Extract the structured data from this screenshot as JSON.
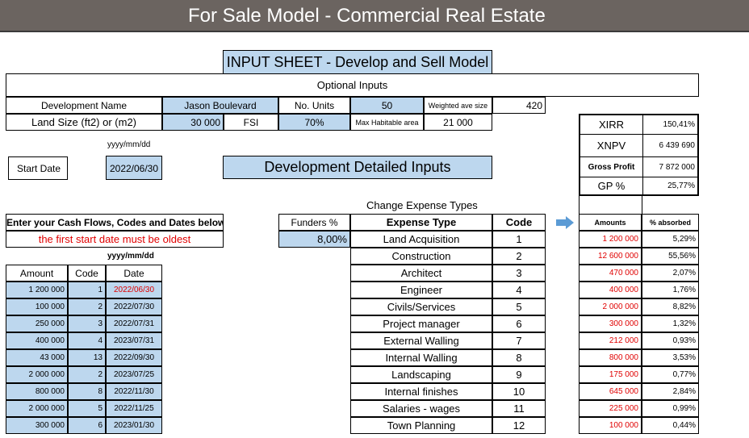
{
  "banner": {
    "title": "For Sale Model - Commercial Real Estate"
  },
  "input_sheet_title": "INPUT SHEET - Develop and Sell Model",
  "optional_inputs": "Optional Inputs",
  "dev_name": {
    "label": "Development Name",
    "value": "Jason Boulevard"
  },
  "units": {
    "label": "No. Units",
    "value": "50"
  },
  "weighted": {
    "label": "Weighted ave size",
    "value": "420"
  },
  "land_size": {
    "label": "Land Size (ft2) or (m2)",
    "value": "30 000"
  },
  "fsi": {
    "label": "FSI",
    "value": "70%"
  },
  "max_hab": {
    "label": "Max Habitable area",
    "value": "21 000"
  },
  "date_format": "yyyy/mm/dd",
  "start_date": {
    "label": "Start Date",
    "value": "2022/06/30"
  },
  "dev_detailed": "Development Detailed Inputs",
  "metrics": [
    {
      "label": "XIRR",
      "value": "150,41%"
    },
    {
      "label": "XNPV",
      "value": "6 439 690"
    },
    {
      "label": "Gross Profit",
      "value": "7 872 000"
    },
    {
      "label": "GP %",
      "value": "25,77%"
    }
  ],
  "change_expense": "Change Expense Types",
  "cash_flow_header": "Enter your Cash Flows, Codes and Dates below",
  "oldest_warning": "the first start date must be oldest",
  "cf_date_format": "yyyy/mm/dd",
  "cf_columns": [
    "Amount",
    "Code",
    "Date"
  ],
  "cash_flows": [
    {
      "amount": "1 200 000",
      "code": "1",
      "date": "2022/06/30"
    },
    {
      "amount": "100 000",
      "code": "2",
      "date": "2022/07/30"
    },
    {
      "amount": "250 000",
      "code": "3",
      "date": "2022/07/31"
    },
    {
      "amount": "400 000",
      "code": "4",
      "date": "2023/07/31"
    },
    {
      "amount": "43 000",
      "code": "13",
      "date": "2022/09/30"
    },
    {
      "amount": "2 000 000",
      "code": "2",
      "date": "2023/07/25"
    },
    {
      "amount": "800 000",
      "code": "8",
      "date": "2022/11/30"
    },
    {
      "amount": "2 000 000",
      "code": "5",
      "date": "2022/11/25"
    },
    {
      "amount": "300 000",
      "code": "6",
      "date": "2023/01/30"
    }
  ],
  "funders": {
    "label": "Funders %",
    "value": "8,00%"
  },
  "expense_columns": [
    "Expense Type",
    "Code"
  ],
  "expenses": [
    {
      "type": "Land Acquisition",
      "code": "1"
    },
    {
      "type": "Construction",
      "code": "2"
    },
    {
      "type": "Architect",
      "code": "3"
    },
    {
      "type": "Engineer",
      "code": "4"
    },
    {
      "type": "Civils/Services",
      "code": "5"
    },
    {
      "type": "Project manager",
      "code": "6"
    },
    {
      "type": "External Walling",
      "code": "7"
    },
    {
      "type": "Internal Walling",
      "code": "8"
    },
    {
      "type": "Landscaping",
      "code": "9"
    },
    {
      "type": "Internal finishes",
      "code": "10"
    },
    {
      "type": "Salaries - wages",
      "code": "11"
    },
    {
      "type": "Town Planning",
      "code": "12"
    }
  ],
  "amount_columns": [
    "Amounts",
    "% absorbed"
  ],
  "amounts": [
    {
      "amount": "1 200 000",
      "pct": "5,29%"
    },
    {
      "amount": "12 600 000",
      "pct": "55,56%"
    },
    {
      "amount": "470 000",
      "pct": "2,07%"
    },
    {
      "amount": "400 000",
      "pct": "1,76%"
    },
    {
      "amount": "2 000 000",
      "pct": "8,82%"
    },
    {
      "amount": "300 000",
      "pct": "1,32%"
    },
    {
      "amount": "212 000",
      "pct": "0,93%"
    },
    {
      "amount": "800 000",
      "pct": "3,53%"
    },
    {
      "amount": "175 000",
      "pct": "0,77%"
    },
    {
      "amount": "645 000",
      "pct": "2,84%"
    },
    {
      "amount": "225 000",
      "pct": "0,99%"
    },
    {
      "amount": "100 000",
      "pct": "0,44%"
    }
  ],
  "colors": {
    "banner": "#6b6460",
    "input_blue": "#bdd7ee",
    "red": "#e00000",
    "arrow": "#5b9bd5"
  }
}
